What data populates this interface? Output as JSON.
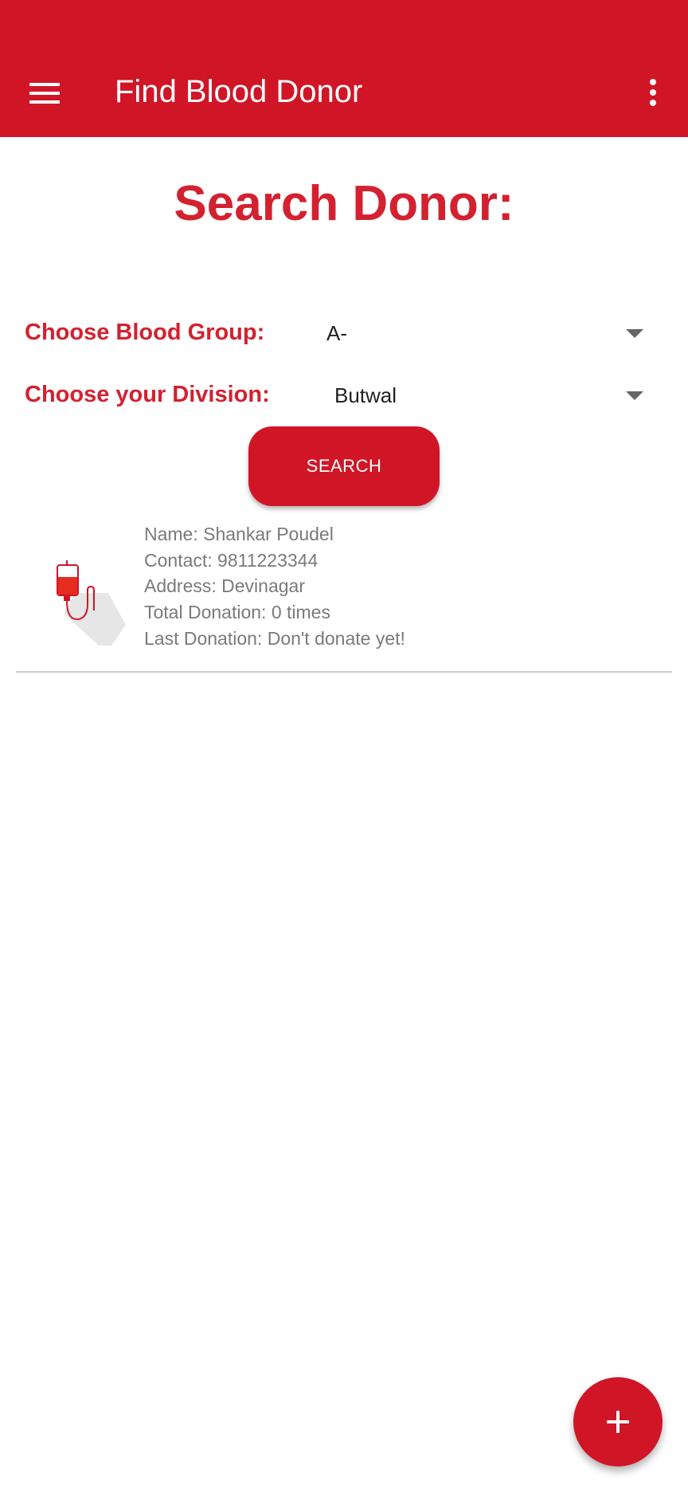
{
  "app_bar": {
    "title": "Find Blood Donor",
    "menu_icon": "hamburger-menu-icon",
    "overflow_icon": "more-vertical-icon",
    "background": "#d01527"
  },
  "main": {
    "heading": "Search Donor:",
    "blood_group": {
      "label": "Choose Blood Group:",
      "selected": "A-"
    },
    "division": {
      "label": "Choose your Division:",
      "selected": "Butwal"
    },
    "search_button": {
      "label": "SEARCH"
    }
  },
  "donors": [
    {
      "icon": "blood-bag-icon",
      "name": "Name: Shankar Poudel",
      "contact": "Contact: 9811223344",
      "address": "Address: Devinagar",
      "total_donation": "Total Donation: 0 times",
      "last_donation": "Last Donation: Don't donate yet!"
    }
  ],
  "fab": {
    "icon": "plus-icon"
  },
  "colors": {
    "accent": "#d32130",
    "primary": "#d01527",
    "secondary_text": "#7a7a7a"
  }
}
